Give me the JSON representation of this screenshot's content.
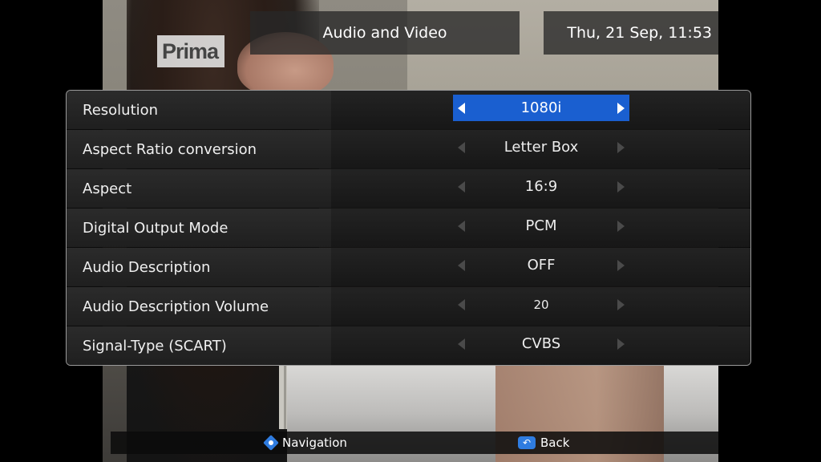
{
  "background": {
    "channel_logo": "Prima"
  },
  "header": {
    "title": "Audio and Video",
    "datetime": "Thu, 21 Sep, 11:53"
  },
  "settings": {
    "rows": [
      {
        "label": "Resolution",
        "value": "1080i",
        "selected": true
      },
      {
        "label": "Aspect Ratio conversion",
        "value": "Letter Box",
        "selected": false
      },
      {
        "label": "Aspect",
        "value": "16:9",
        "selected": false
      },
      {
        "label": "Digital Output Mode",
        "value": "PCM",
        "selected": false
      },
      {
        "label": "Audio Description",
        "value": "OFF",
        "selected": false
      },
      {
        "label": "Audio Description Volume",
        "value": "20",
        "selected": false
      },
      {
        "label": "Signal-Type (SCART)",
        "value": "CVBS",
        "selected": false
      }
    ]
  },
  "footer": {
    "navigation_label": "Navigation",
    "navigation_icon": "dpad-icon",
    "back_label": "Back",
    "back_icon": "return-icon"
  },
  "colors": {
    "highlight": "#1a5fd0",
    "icon_accent": "#2f7ce0"
  }
}
